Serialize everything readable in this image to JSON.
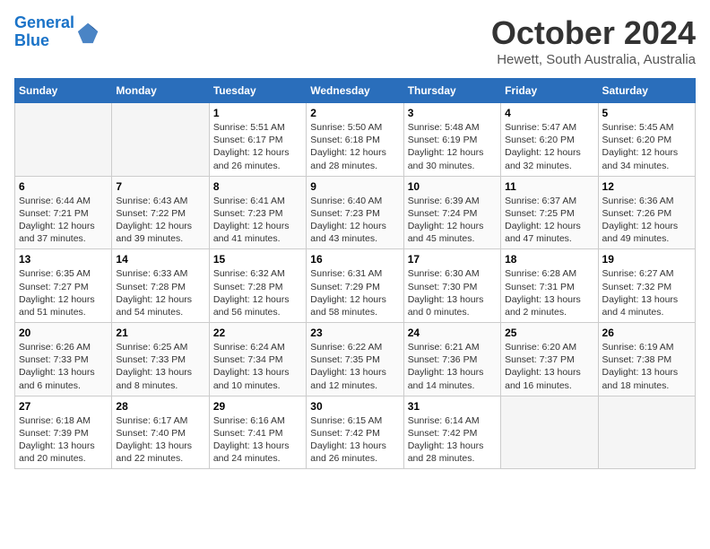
{
  "header": {
    "logo_line1": "General",
    "logo_line2": "Blue",
    "month_title": "October 2024",
    "location": "Hewett, South Australia, Australia"
  },
  "days_of_week": [
    "Sunday",
    "Monday",
    "Tuesday",
    "Wednesday",
    "Thursday",
    "Friday",
    "Saturday"
  ],
  "weeks": [
    [
      {
        "day": "",
        "info": ""
      },
      {
        "day": "",
        "info": ""
      },
      {
        "day": "1",
        "info": "Sunrise: 5:51 AM\nSunset: 6:17 PM\nDaylight: 12 hours and 26 minutes."
      },
      {
        "day": "2",
        "info": "Sunrise: 5:50 AM\nSunset: 6:18 PM\nDaylight: 12 hours and 28 minutes."
      },
      {
        "day": "3",
        "info": "Sunrise: 5:48 AM\nSunset: 6:19 PM\nDaylight: 12 hours and 30 minutes."
      },
      {
        "day": "4",
        "info": "Sunrise: 5:47 AM\nSunset: 6:20 PM\nDaylight: 12 hours and 32 minutes."
      },
      {
        "day": "5",
        "info": "Sunrise: 5:45 AM\nSunset: 6:20 PM\nDaylight: 12 hours and 34 minutes."
      }
    ],
    [
      {
        "day": "6",
        "info": "Sunrise: 6:44 AM\nSunset: 7:21 PM\nDaylight: 12 hours and 37 minutes."
      },
      {
        "day": "7",
        "info": "Sunrise: 6:43 AM\nSunset: 7:22 PM\nDaylight: 12 hours and 39 minutes."
      },
      {
        "day": "8",
        "info": "Sunrise: 6:41 AM\nSunset: 7:23 PM\nDaylight: 12 hours and 41 minutes."
      },
      {
        "day": "9",
        "info": "Sunrise: 6:40 AM\nSunset: 7:23 PM\nDaylight: 12 hours and 43 minutes."
      },
      {
        "day": "10",
        "info": "Sunrise: 6:39 AM\nSunset: 7:24 PM\nDaylight: 12 hours and 45 minutes."
      },
      {
        "day": "11",
        "info": "Sunrise: 6:37 AM\nSunset: 7:25 PM\nDaylight: 12 hours and 47 minutes."
      },
      {
        "day": "12",
        "info": "Sunrise: 6:36 AM\nSunset: 7:26 PM\nDaylight: 12 hours and 49 minutes."
      }
    ],
    [
      {
        "day": "13",
        "info": "Sunrise: 6:35 AM\nSunset: 7:27 PM\nDaylight: 12 hours and 51 minutes."
      },
      {
        "day": "14",
        "info": "Sunrise: 6:33 AM\nSunset: 7:28 PM\nDaylight: 12 hours and 54 minutes."
      },
      {
        "day": "15",
        "info": "Sunrise: 6:32 AM\nSunset: 7:28 PM\nDaylight: 12 hours and 56 minutes."
      },
      {
        "day": "16",
        "info": "Sunrise: 6:31 AM\nSunset: 7:29 PM\nDaylight: 12 hours and 58 minutes."
      },
      {
        "day": "17",
        "info": "Sunrise: 6:30 AM\nSunset: 7:30 PM\nDaylight: 13 hours and 0 minutes."
      },
      {
        "day": "18",
        "info": "Sunrise: 6:28 AM\nSunset: 7:31 PM\nDaylight: 13 hours and 2 minutes."
      },
      {
        "day": "19",
        "info": "Sunrise: 6:27 AM\nSunset: 7:32 PM\nDaylight: 13 hours and 4 minutes."
      }
    ],
    [
      {
        "day": "20",
        "info": "Sunrise: 6:26 AM\nSunset: 7:33 PM\nDaylight: 13 hours and 6 minutes."
      },
      {
        "day": "21",
        "info": "Sunrise: 6:25 AM\nSunset: 7:33 PM\nDaylight: 13 hours and 8 minutes."
      },
      {
        "day": "22",
        "info": "Sunrise: 6:24 AM\nSunset: 7:34 PM\nDaylight: 13 hours and 10 minutes."
      },
      {
        "day": "23",
        "info": "Sunrise: 6:22 AM\nSunset: 7:35 PM\nDaylight: 13 hours and 12 minutes."
      },
      {
        "day": "24",
        "info": "Sunrise: 6:21 AM\nSunset: 7:36 PM\nDaylight: 13 hours and 14 minutes."
      },
      {
        "day": "25",
        "info": "Sunrise: 6:20 AM\nSunset: 7:37 PM\nDaylight: 13 hours and 16 minutes."
      },
      {
        "day": "26",
        "info": "Sunrise: 6:19 AM\nSunset: 7:38 PM\nDaylight: 13 hours and 18 minutes."
      }
    ],
    [
      {
        "day": "27",
        "info": "Sunrise: 6:18 AM\nSunset: 7:39 PM\nDaylight: 13 hours and 20 minutes."
      },
      {
        "day": "28",
        "info": "Sunrise: 6:17 AM\nSunset: 7:40 PM\nDaylight: 13 hours and 22 minutes."
      },
      {
        "day": "29",
        "info": "Sunrise: 6:16 AM\nSunset: 7:41 PM\nDaylight: 13 hours and 24 minutes."
      },
      {
        "day": "30",
        "info": "Sunrise: 6:15 AM\nSunset: 7:42 PM\nDaylight: 13 hours and 26 minutes."
      },
      {
        "day": "31",
        "info": "Sunrise: 6:14 AM\nSunset: 7:42 PM\nDaylight: 13 hours and 28 minutes."
      },
      {
        "day": "",
        "info": ""
      },
      {
        "day": "",
        "info": ""
      }
    ]
  ]
}
